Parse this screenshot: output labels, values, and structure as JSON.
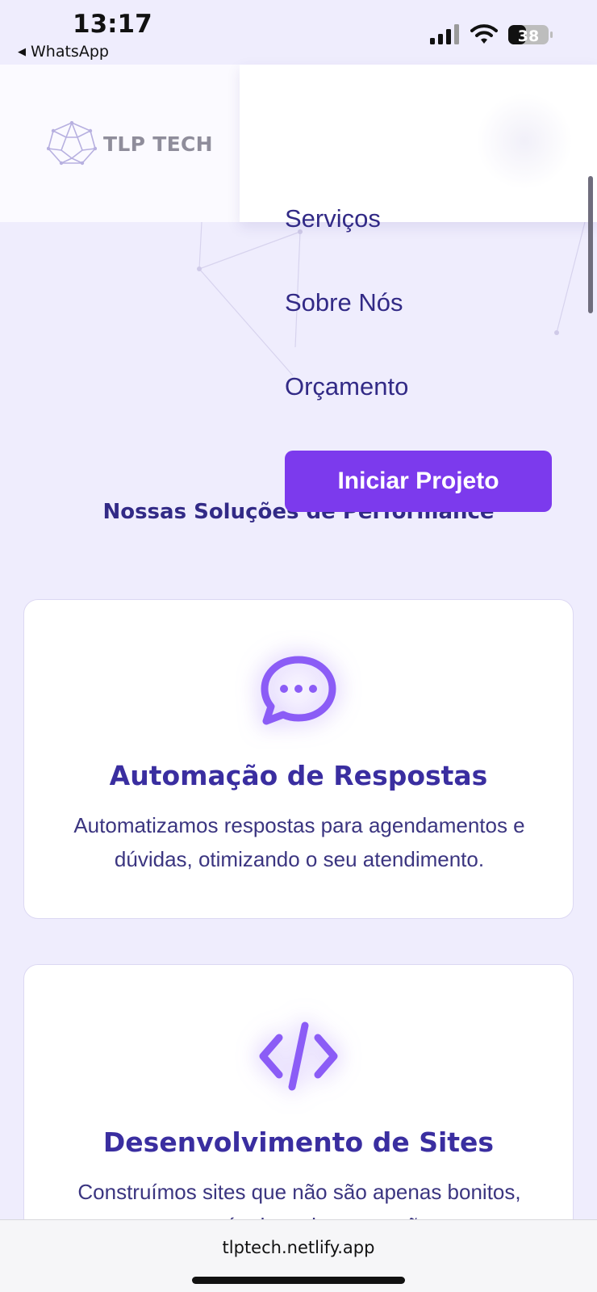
{
  "status_bar": {
    "time": "13:17",
    "back_app": "WhatsApp",
    "battery": "38",
    "icons": [
      "signal-icon",
      "wifi-icon",
      "battery-icon"
    ]
  },
  "header": {
    "logo_text": "TLP TECH",
    "logo_icon": "polyhedron-logo-icon"
  },
  "menu": {
    "items": [
      {
        "label": "Serviços"
      },
      {
        "label": "Sobre Nós"
      },
      {
        "label": "Orçamento"
      }
    ],
    "cta_label": "Iniciar Projeto"
  },
  "section": {
    "title": "Nossas Soluções de Performance"
  },
  "services": [
    {
      "icon": "chat-bubble-icon",
      "title": "Automação de Respostas",
      "description": "Automatizamos respostas para agendamentos e dúvidas, otimizando o seu atendimento."
    },
    {
      "icon": "code-icon",
      "title": "Desenvolvimento de Sites",
      "description": "Construímos sites que não são apenas bonitos, mas máquinas de conversão."
    }
  ],
  "browser": {
    "url": "tlptech.netlify.app"
  },
  "colors": {
    "accent": "#7c3aed",
    "heading": "#322a86",
    "background": "#efedfd"
  }
}
